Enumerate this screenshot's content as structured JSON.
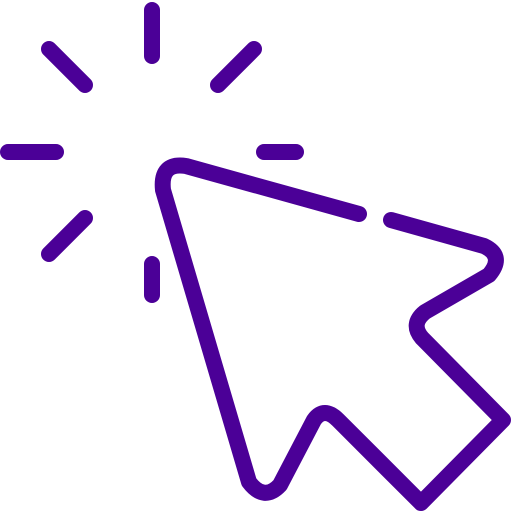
{
  "icon": {
    "name": "cursor-click-icon",
    "color": "#4b0097",
    "background": "#ffffff"
  }
}
